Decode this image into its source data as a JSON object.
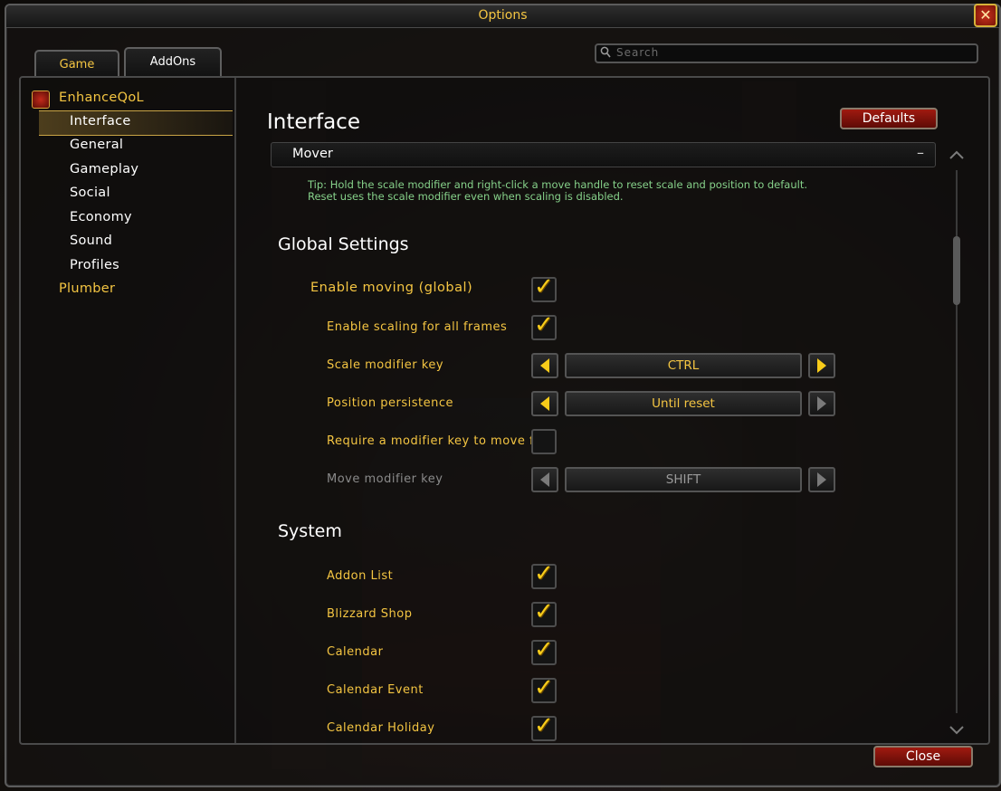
{
  "window": {
    "title": "Options",
    "close_glyph": "✕"
  },
  "tabs": [
    {
      "label": "Game",
      "active": false
    },
    {
      "label": "AddOns",
      "active": true
    }
  ],
  "search": {
    "placeholder": "Search"
  },
  "sidebar": {
    "root": "EnhanceQoL",
    "items": [
      "Interface",
      "General",
      "Gameplay",
      "Social",
      "Economy",
      "Sound",
      "Profiles"
    ],
    "selected": "Interface",
    "plumber": "Plumber"
  },
  "content": {
    "title": "Interface",
    "defaults_label": "Defaults",
    "section": {
      "label": "Mover",
      "collapse_glyph": "–"
    },
    "tip_line1": "Tip: Hold the scale modifier and right-click a move handle to reset scale and position to default.",
    "tip_line2": "Reset uses the scale modifier even when scaling is disabled.",
    "global": {
      "heading": "Global Settings",
      "enable_moving": {
        "label": "Enable moving (global)",
        "checked": true
      },
      "enable_scaling": {
        "label": "Enable scaling for all frames",
        "checked": true
      },
      "scale_modifier": {
        "label": "Scale modifier key",
        "value": "CTRL"
      },
      "position_persistence": {
        "label": "Position persistence",
        "value": "Until reset"
      },
      "require_modifier": {
        "label": "Require a modifier key to move f...",
        "checked": false
      },
      "move_modifier": {
        "label": "Move modifier key",
        "value": "SHIFT",
        "disabled": true
      }
    },
    "system": {
      "heading": "System",
      "items": [
        {
          "label": "Addon List",
          "checked": true
        },
        {
          "label": "Blizzard Shop",
          "checked": true
        },
        {
          "label": "Calendar",
          "checked": true
        },
        {
          "label": "Calendar Event",
          "checked": true
        },
        {
          "label": "Calendar Holiday",
          "checked": true
        }
      ]
    }
  },
  "footer": {
    "close_label": "Close"
  },
  "colors": {
    "gold": "#f4c542",
    "check": "#f8cc1a",
    "tip_green": "#86d18a",
    "button_red": "#a01a10"
  },
  "check_glyph": "✓"
}
